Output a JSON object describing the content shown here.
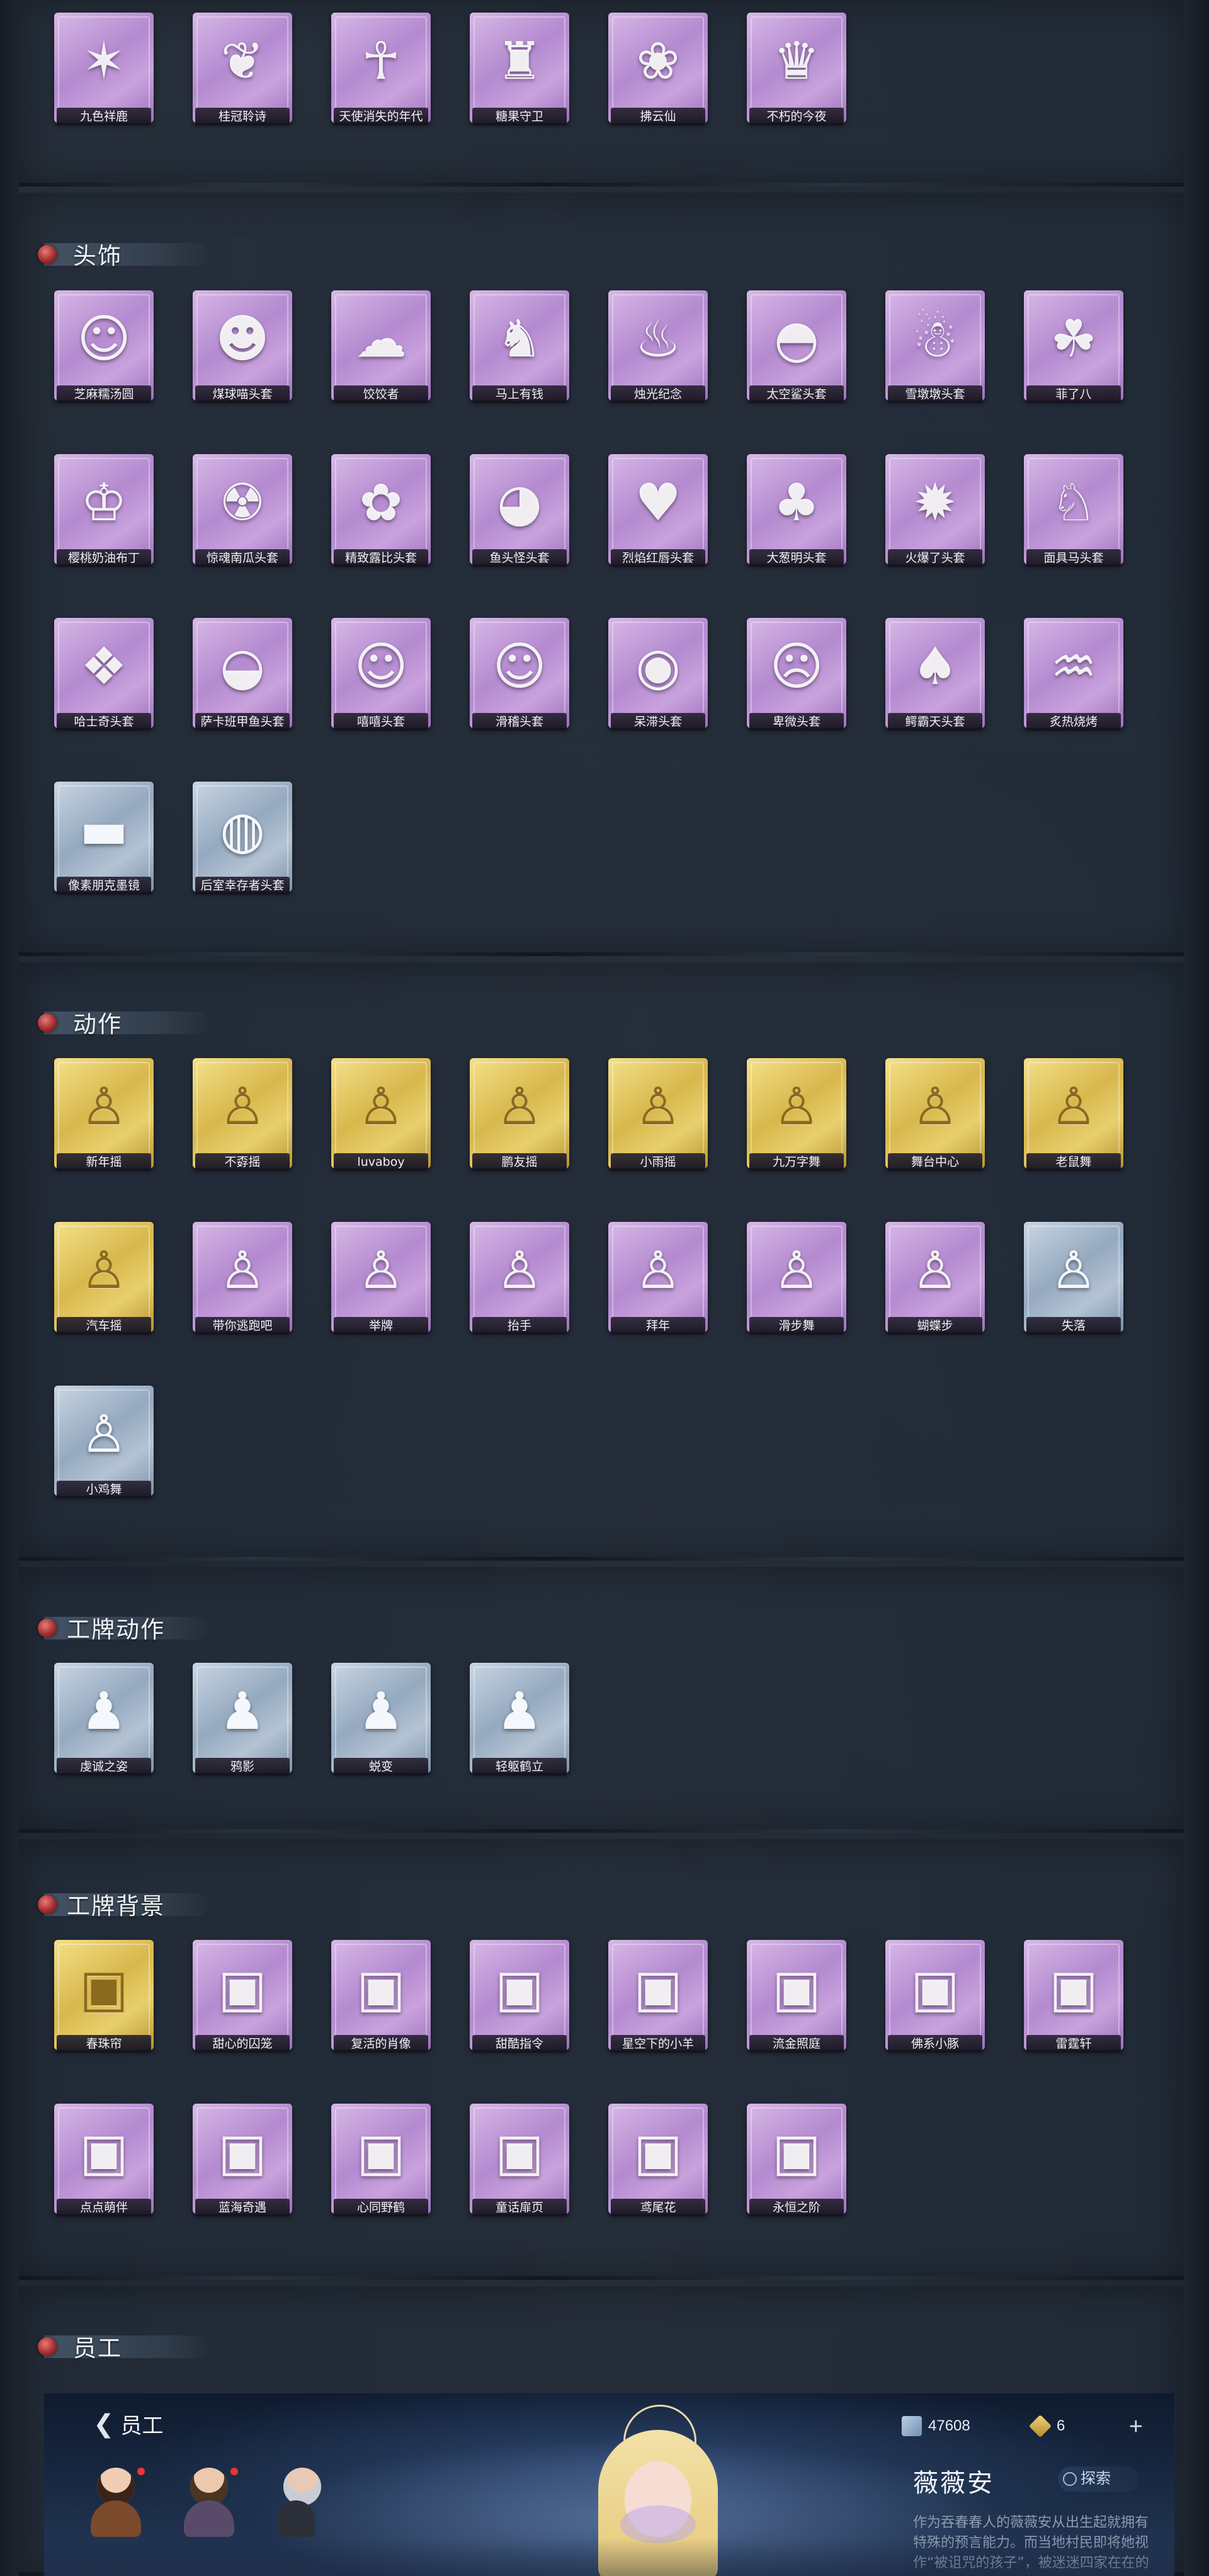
{
  "sections": {
    "top_row": {
      "items": [
        {
          "label": "九色祥鹿",
          "rarity": "purple",
          "icon": "deer-charm-icon",
          "glyph": "✶"
        },
        {
          "label": "桂冠聆诗",
          "rarity": "purple",
          "icon": "laurel-charm-icon",
          "glyph": "❦"
        },
        {
          "label": "天使消失的年代",
          "rarity": "purple",
          "icon": "angel-charm-icon",
          "glyph": "☥"
        },
        {
          "label": "糖果守卫",
          "rarity": "purple",
          "icon": "candy-guard-icon",
          "glyph": "♜"
        },
        {
          "label": "拂云仙",
          "rarity": "purple",
          "icon": "cloud-fairy-icon",
          "glyph": "❀"
        },
        {
          "label": "不朽的今夜",
          "rarity": "purple",
          "icon": "eternal-night-icon",
          "glyph": "♛"
        }
      ]
    },
    "headwear": {
      "title": "头饰",
      "items": [
        {
          "label": "芝麻糯汤圆",
          "rarity": "purple",
          "icon": "rice-ball-icon",
          "glyph": "☺"
        },
        {
          "label": "煤球喵头套",
          "rarity": "purple",
          "icon": "black-cat-icon",
          "glyph": "☻"
        },
        {
          "label": "饺饺者",
          "rarity": "purple",
          "icon": "dumpling-icon",
          "glyph": "☁"
        },
        {
          "label": "马上有钱",
          "rarity": "purple",
          "icon": "horse-money-icon",
          "glyph": "♞"
        },
        {
          "label": "烛光纪念",
          "rarity": "purple",
          "icon": "candle-icon",
          "glyph": "♨"
        },
        {
          "label": "太空鲨头套",
          "rarity": "purple",
          "icon": "space-shark-icon",
          "glyph": "◓"
        },
        {
          "label": "雪墩墩头套",
          "rarity": "purple",
          "icon": "snowman-icon",
          "glyph": "☃"
        },
        {
          "label": "菲了八",
          "rarity": "purple",
          "icon": "radish-icon",
          "glyph": "☘"
        },
        {
          "label": "樱桃奶油布丁",
          "rarity": "purple",
          "icon": "pudding-icon",
          "glyph": "♔"
        },
        {
          "label": "惊魂南瓜头套",
          "rarity": "purple",
          "icon": "pumpkin-icon",
          "glyph": "☢"
        },
        {
          "label": "精致露比头套",
          "rarity": "purple",
          "icon": "pink-pig-icon",
          "glyph": "✿"
        },
        {
          "label": "鱼头怪头套",
          "rarity": "purple",
          "icon": "fish-head-icon",
          "glyph": "◕"
        },
        {
          "label": "烈焰红唇头套",
          "rarity": "purple",
          "icon": "red-lips-icon",
          "glyph": "♥"
        },
        {
          "label": "大葱明头套",
          "rarity": "purple",
          "icon": "scallion-icon",
          "glyph": "♣"
        },
        {
          "label": "火爆了头套",
          "rarity": "purple",
          "icon": "fireball-icon",
          "glyph": "✹"
        },
        {
          "label": "面具马头套",
          "rarity": "purple",
          "icon": "horse-mask-icon",
          "glyph": "♘"
        },
        {
          "label": "哈士奇头套",
          "rarity": "purple",
          "icon": "husky-icon",
          "glyph": "❖"
        },
        {
          "label": "萨卡班甲鱼头套",
          "rarity": "purple",
          "icon": "ancient-fish-icon",
          "glyph": "◒"
        },
        {
          "label": "嘻嘻头套",
          "rarity": "purple",
          "icon": "grin-emoji-icon",
          "glyph": "☺"
        },
        {
          "label": "滑稽头套",
          "rarity": "purple",
          "icon": "funny-emoji-icon",
          "glyph": "☺"
        },
        {
          "label": "呆滞头套",
          "rarity": "purple",
          "icon": "dazed-emoji-icon",
          "glyph": "◉"
        },
        {
          "label": "卑微头套",
          "rarity": "purple",
          "icon": "humble-emoji-icon",
          "glyph": "☹"
        },
        {
          "label": "鳄霸天头套",
          "rarity": "purple",
          "icon": "crocodile-icon",
          "glyph": "♠"
        },
        {
          "label": "炙热烧烤",
          "rarity": "purple",
          "icon": "bbq-icon",
          "glyph": "♒"
        },
        {
          "label": "像素朋克墨镜",
          "rarity": "blue",
          "icon": "pixel-sunglasses-icon",
          "glyph": "▬"
        },
        {
          "label": "后室幸存者头套",
          "rarity": "blue",
          "icon": "gas-mask-icon",
          "glyph": "◍"
        }
      ]
    },
    "emotes": {
      "title": "动作",
      "items": [
        {
          "label": "新年摇",
          "rarity": "gold",
          "icon": "pose-icon",
          "glyph": "♙"
        },
        {
          "label": "不孬摇",
          "rarity": "gold",
          "icon": "pose-icon",
          "glyph": "♙"
        },
        {
          "label": "luvaboy",
          "rarity": "gold",
          "icon": "pose-icon",
          "glyph": "♙"
        },
        {
          "label": "鹏友摇",
          "rarity": "gold",
          "icon": "pose-icon",
          "glyph": "♙"
        },
        {
          "label": "小雨摇",
          "rarity": "gold",
          "icon": "pose-icon",
          "glyph": "♙"
        },
        {
          "label": "九万字舞",
          "rarity": "gold",
          "icon": "pose-icon",
          "glyph": "♙"
        },
        {
          "label": "舞台中心",
          "rarity": "gold",
          "icon": "pose-icon",
          "glyph": "♙"
        },
        {
          "label": "老鼠舞",
          "rarity": "gold",
          "icon": "pose-icon",
          "glyph": "♙"
        },
        {
          "label": "汽车摇",
          "rarity": "gold",
          "icon": "pose-icon",
          "glyph": "♙"
        },
        {
          "label": "带你逃跑吧",
          "rarity": "purple",
          "icon": "pose-icon",
          "glyph": "♙"
        },
        {
          "label": "举牌",
          "rarity": "purple",
          "icon": "sign-pose-icon",
          "glyph": "♙"
        },
        {
          "label": "抬手",
          "rarity": "purple",
          "icon": "pose-icon",
          "glyph": "♙"
        },
        {
          "label": "拜年",
          "rarity": "purple",
          "icon": "pose-icon",
          "glyph": "♙"
        },
        {
          "label": "滑步舞",
          "rarity": "purple",
          "icon": "pose-icon",
          "glyph": "♙"
        },
        {
          "label": "蝴蝶步",
          "rarity": "purple",
          "icon": "pose-icon",
          "glyph": "♙"
        },
        {
          "label": "失落",
          "rarity": "blue",
          "icon": "crawl-pose-icon",
          "glyph": "♙"
        },
        {
          "label": "小鸡舞",
          "rarity": "blue",
          "icon": "pose-icon",
          "glyph": "♙"
        }
      ]
    },
    "badge_emotes": {
      "title": "工牌动作",
      "items": [
        {
          "label": "虔诚之姿",
          "rarity": "blue",
          "icon": "badge-pose-icon",
          "glyph": "♟"
        },
        {
          "label": "鸦影",
          "rarity": "blue",
          "icon": "badge-pose-icon",
          "glyph": "♟"
        },
        {
          "label": "蜕变",
          "rarity": "blue",
          "icon": "badge-pose-icon",
          "glyph": "♟"
        },
        {
          "label": "轻躯鹤立",
          "rarity": "blue",
          "icon": "badge-pose-icon",
          "glyph": "♟"
        }
      ]
    },
    "badge_backgrounds": {
      "title": "工牌背景",
      "items": [
        {
          "label": "春珠帘",
          "rarity": "gold",
          "icon": "card-frame-icon",
          "glyph": "▣"
        },
        {
          "label": "甜心的囚笼",
          "rarity": "purple",
          "icon": "card-frame-icon",
          "glyph": "▣"
        },
        {
          "label": "复活的肖像",
          "rarity": "purple",
          "icon": "card-frame-icon",
          "glyph": "▣"
        },
        {
          "label": "甜酷指令",
          "rarity": "purple",
          "icon": "card-frame-icon",
          "glyph": "▣"
        },
        {
          "label": "星空下的小羊",
          "rarity": "purple",
          "icon": "card-frame-icon",
          "glyph": "▣"
        },
        {
          "label": "流金照庭",
          "rarity": "purple",
          "icon": "card-frame-icon",
          "glyph": "▣"
        },
        {
          "label": "佛系小豚",
          "rarity": "purple",
          "icon": "card-frame-icon",
          "glyph": "▣"
        },
        {
          "label": "雷霆轩",
          "rarity": "purple",
          "icon": "card-frame-icon",
          "glyph": "▣"
        },
        {
          "label": "点点萌伴",
          "rarity": "purple",
          "icon": "card-frame-icon",
          "glyph": "▣"
        },
        {
          "label": "蓝海奇遇",
          "rarity": "purple",
          "icon": "card-frame-icon",
          "glyph": "▣"
        },
        {
          "label": "心同野鹤",
          "rarity": "purple",
          "icon": "card-frame-icon",
          "glyph": "▣"
        },
        {
          "label": "童话扉页",
          "rarity": "purple",
          "icon": "card-frame-icon",
          "glyph": "▣"
        },
        {
          "label": "鸢尾花",
          "rarity": "purple",
          "icon": "card-frame-icon",
          "glyph": "▣"
        },
        {
          "label": "永恒之阶",
          "rarity": "purple",
          "icon": "card-frame-icon",
          "glyph": "▣"
        }
      ]
    },
    "staff": {
      "title": "员工",
      "back_label": "员工",
      "currency1": "47608",
      "currency2": "6",
      "character_name": "薇薇安",
      "explore_label": "探索",
      "description": "作为吞春春人的薇薇安从出生起就拥有特殊的预言能力。而当地村民即将她视作“被诅咒的孩子”，被迷迷四家在在的面面面面面面。"
    }
  },
  "colors": {
    "purple_card": "#c8a2dd",
    "gold_card": "#e8cf6e",
    "blue_card": "#b4c3d4",
    "panel": "#242e3a",
    "accent_red": "#a32c2c"
  }
}
